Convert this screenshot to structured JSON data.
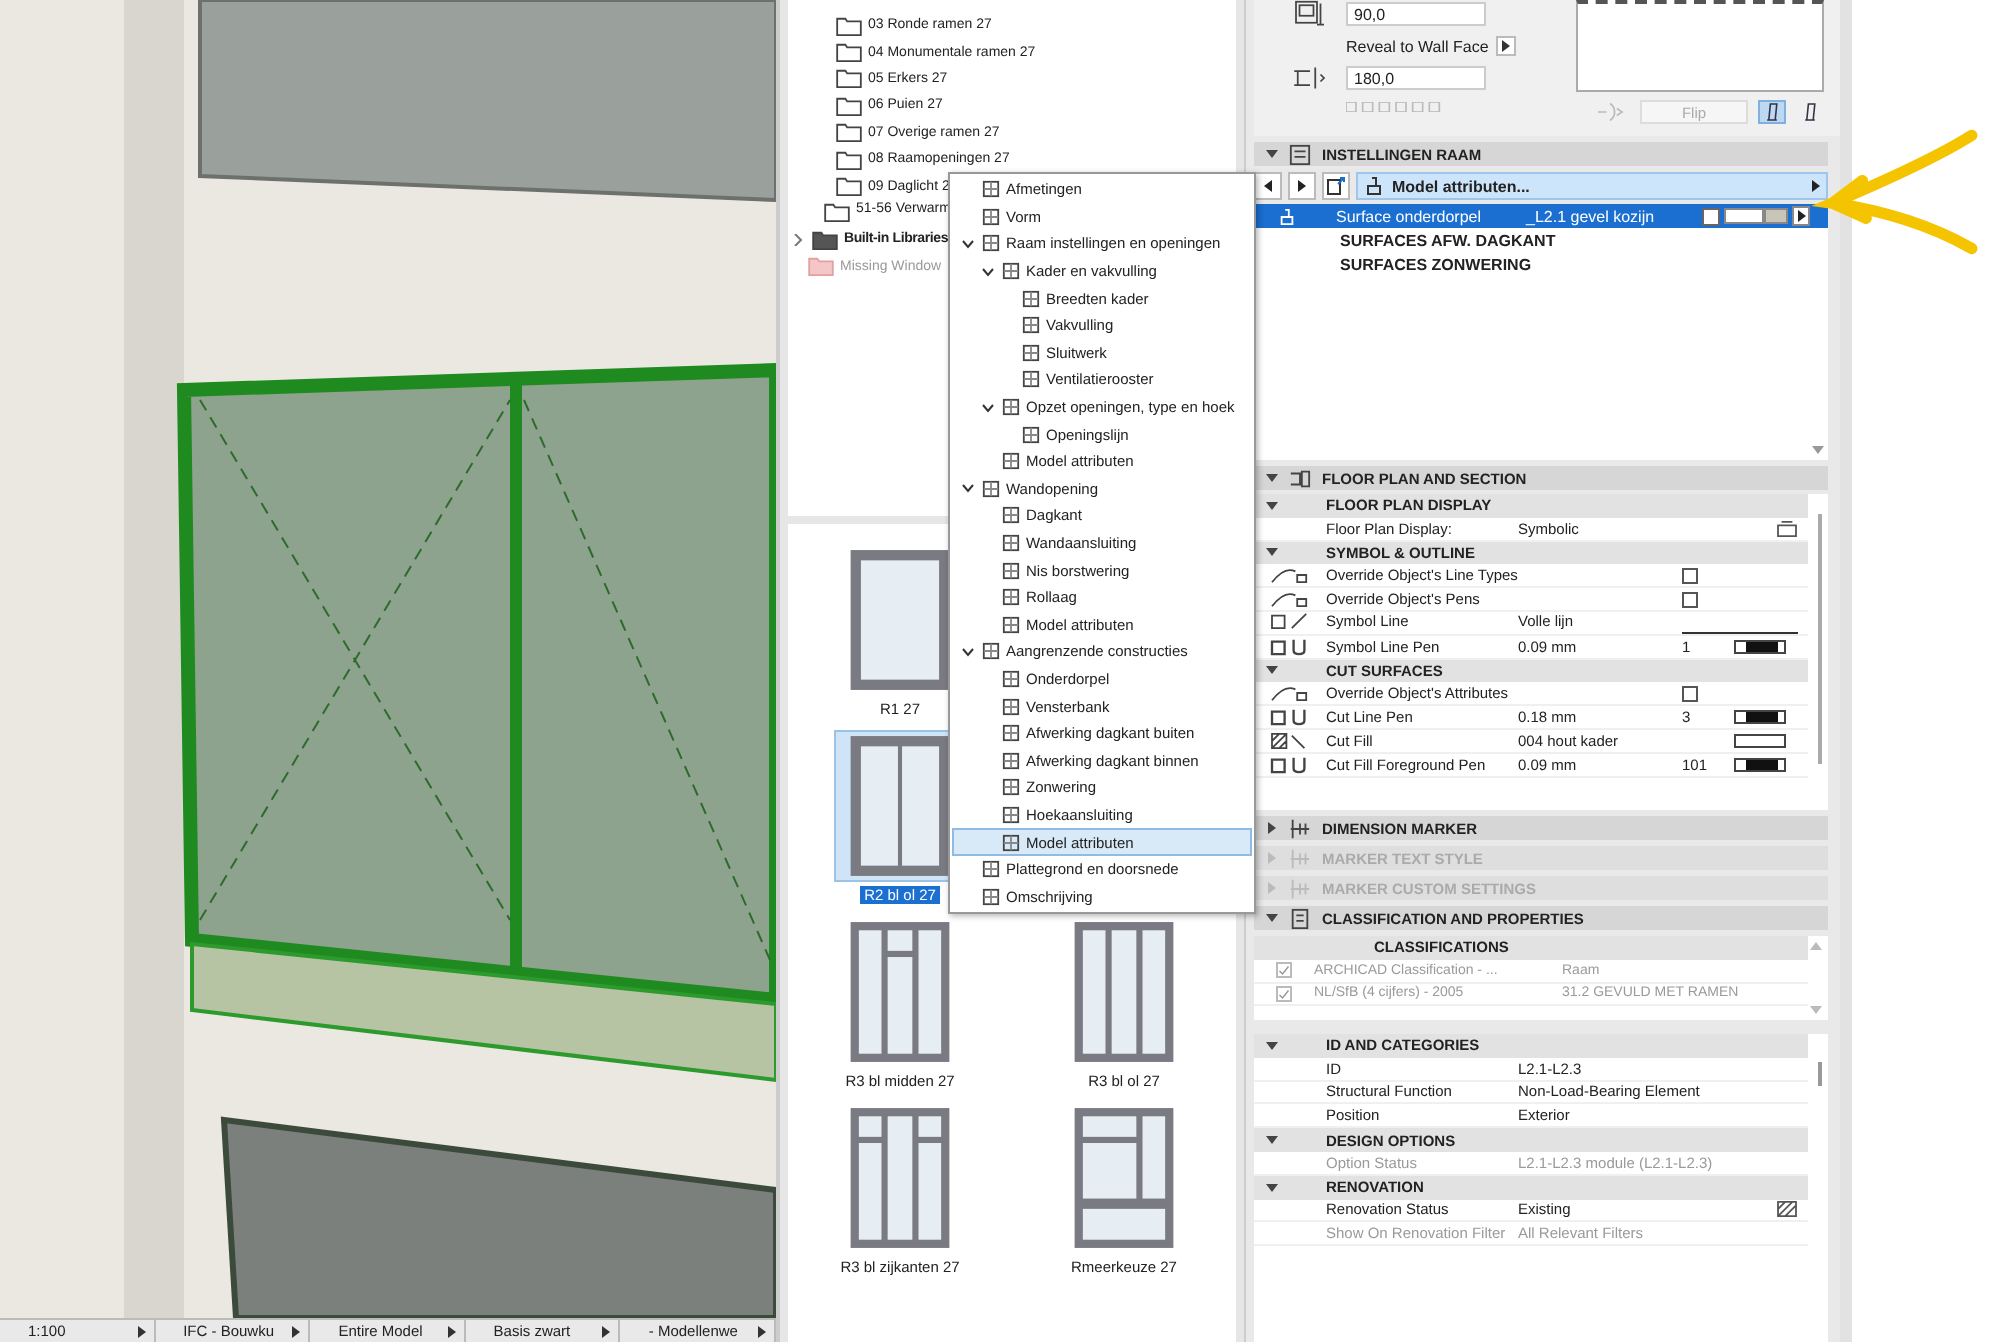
{
  "viewport": {
    "status_bar": [
      {
        "label": "1:100"
      },
      {
        "label": "IFC - Bouwku"
      },
      {
        "label": "Entire Model"
      },
      {
        "label": "Basis zwart"
      },
      {
        "label": "- Modellenwe"
      }
    ]
  },
  "library_tree": {
    "items": [
      {
        "label": "03 Ronde ramen 27",
        "kind": "subfolder"
      },
      {
        "label": "04 Monumentale ramen 27",
        "kind": "subfolder"
      },
      {
        "label": "05 Erkers 27",
        "kind": "subfolder"
      },
      {
        "label": "06 Puien 27",
        "kind": "subfolder"
      },
      {
        "label": "07 Overige ramen 27",
        "kind": "subfolder"
      },
      {
        "label": "08 Raamopeningen 27",
        "kind": "subfolder"
      },
      {
        "label": "09 Daglicht 2",
        "kind": "subfolder"
      },
      {
        "label": "51-56 Verwarm",
        "kind": "folder"
      },
      {
        "label": "Built-in Libraries",
        "kind": "library",
        "expanded": false
      },
      {
        "label": "Missing Window",
        "kind": "missing"
      }
    ]
  },
  "thumbnails": {
    "rows": [
      [
        {
          "label": "R1 27",
          "kind": "single",
          "selected": false
        }
      ],
      [
        {
          "label": "R2 bl ol 27",
          "kind": "double",
          "selected": true
        }
      ],
      [
        {
          "label": "R3 bl midden 27",
          "kind": "triple-middle",
          "selected": false
        },
        {
          "label": "R3 bl ol 27",
          "kind": "triple",
          "selected": false
        }
      ],
      [
        {
          "label": "R3 bl zijkanten 27",
          "kind": "triple-sides",
          "selected": false
        },
        {
          "label": "Rmeerkeuze 27",
          "kind": "multi",
          "selected": false
        }
      ]
    ]
  },
  "menu": {
    "items": [
      {
        "label": "Afmetingen",
        "selected": false
      },
      {
        "label": "Vorm",
        "selected": false
      },
      {
        "label": "Raam instellingen en openingen",
        "selected": false,
        "expanded": true,
        "children": [
          {
            "label": "Kader en vakvulling",
            "selected": false,
            "expanded": true,
            "children": [
              {
                "label": "Breedten kader",
                "selected": false
              },
              {
                "label": "Vakvulling",
                "selected": false
              },
              {
                "label": "Sluitwerk",
                "selected": false
              },
              {
                "label": "Ventilatierooster",
                "selected": false
              }
            ]
          },
          {
            "label": "Opzet openingen, type en hoek",
            "selected": false,
            "expanded": true,
            "children": [
              {
                "label": "Openingslijn",
                "selected": false
              }
            ]
          },
          {
            "label": "Model attributen",
            "selected": false
          }
        ]
      },
      {
        "label": "Wandopening",
        "selected": false,
        "expanded": true,
        "children": [
          {
            "label": "Dagkant",
            "selected": false
          },
          {
            "label": "Wandaansluiting",
            "selected": false
          },
          {
            "label": "Nis borstwering",
            "selected": false
          },
          {
            "label": "Rollaag",
            "selected": false
          },
          {
            "label": "Model attributen",
            "selected": false
          }
        ]
      },
      {
        "label": "Aangrenzende constructies",
        "selected": false,
        "expanded": true,
        "children": [
          {
            "label": "Onderdorpel",
            "selected": false
          },
          {
            "label": "Vensterbank",
            "selected": false
          },
          {
            "label": "Afwerking dagkant buiten",
            "selected": false
          },
          {
            "label": "Afwerking dagkant binnen",
            "selected": false
          },
          {
            "label": "Zonwering",
            "selected": false
          },
          {
            "label": "Hoekaansluiting",
            "selected": false
          },
          {
            "label": "Model attributen",
            "selected": true
          }
        ]
      },
      {
        "label": "Plattegrond en doorsnede",
        "selected": false
      },
      {
        "label": "Omschrijving",
        "selected": false
      }
    ]
  },
  "window_settings": {
    "field_1": "90,0",
    "reveal_label": "Reveal to Wall Face",
    "field_2": "180,0",
    "flip_button": {
      "label": "Flip",
      "disabled": true
    },
    "orientation_toggles": [
      {
        "selected": true
      },
      {
        "selected": false
      }
    ]
  },
  "instellingen_raam": {
    "title": "INSTELLINGEN RAAM",
    "expanded": true,
    "dropdown": "Model attributen...",
    "rows": [
      {
        "kind": "surface",
        "label": "Surface onderdorpel",
        "value": "_L2.1 gevel kozijn",
        "selected": true
      },
      {
        "kind": "heading",
        "label": "SURFACES AFW. DAGKANT",
        "selected": false
      },
      {
        "kind": "heading",
        "label": "SURFACES ZONWERING",
        "selected": false
      }
    ]
  },
  "floor_plan_section": {
    "title": "FLOOR PLAN AND SECTION",
    "expanded": true,
    "groups": [
      {
        "title": "FLOOR PLAN DISPLAY",
        "expanded": true,
        "rows": [
          {
            "kind": "icon-value",
            "label": "Floor Plan Display:",
            "value": "Symbolic"
          }
        ]
      },
      {
        "title": "SYMBOL & OUTLINE",
        "expanded": true,
        "rows": [
          {
            "kind": "checkbox",
            "label": "Override Object's Line Types",
            "checked": false
          },
          {
            "kind": "checkbox",
            "label": "Override Object's Pens",
            "checked": false
          },
          {
            "kind": "line",
            "label": "Symbol Line",
            "value": "Volle lijn"
          },
          {
            "kind": "pen",
            "label": "Symbol Line Pen",
            "value": "0.09 mm",
            "number": "1"
          }
        ]
      },
      {
        "title": "CUT SURFACES",
        "expanded": true,
        "rows": [
          {
            "kind": "checkbox",
            "label": "Override Object's Attributes",
            "checked": false
          },
          {
            "kind": "pen",
            "label": "Cut Line Pen",
            "value": "0.18 mm",
            "number": "3"
          },
          {
            "kind": "fill",
            "label": "Cut Fill",
            "value": "004 hout kader"
          },
          {
            "kind": "pen",
            "label": "Cut Fill Foreground Pen",
            "value": "0.09 mm",
            "number": "101"
          }
        ]
      }
    ]
  },
  "collapsed_sections": [
    {
      "title": "DIMENSION MARKER",
      "expanded": false,
      "disabled": false
    },
    {
      "title": "MARKER TEXT STYLE",
      "expanded": false,
      "disabled": true
    },
    {
      "title": "MARKER CUSTOM SETTINGS",
      "expanded": false,
      "disabled": true
    }
  ],
  "classification": {
    "title": "CLASSIFICATION AND PROPERTIES",
    "expanded": true,
    "subtitle": "CLASSIFICATIONS",
    "rows": [
      {
        "label": "ARCHICAD Classification - ...",
        "value": "Raam",
        "checked": true,
        "disabled": true
      },
      {
        "label": "NL/SfB (4 cijfers) - 2005",
        "value": "31.2 GEVULD MET RAMEN",
        "checked": true,
        "disabled": true
      }
    ]
  },
  "properties": {
    "groups": [
      {
        "title": "ID AND CATEGORIES",
        "expanded": true,
        "rows": [
          {
            "kind": "text",
            "label": "ID",
            "value": "L2.1-L2.3",
            "disabled": false
          },
          {
            "kind": "text",
            "label": "Structural Function",
            "value": "Non-Load-Bearing Element",
            "disabled": false
          },
          {
            "kind": "text",
            "label": "Position",
            "value": "Exterior",
            "disabled": false
          }
        ]
      },
      {
        "title": "DESIGN OPTIONS",
        "expanded": true,
        "rows": [
          {
            "kind": "text",
            "label": "Option Status",
            "value": "L2.1-L2.3 module (L2.1-L2.3)",
            "disabled": true
          }
        ]
      },
      {
        "title": "RENOVATION",
        "expanded": true,
        "rows": [
          {
            "kind": "icon-value",
            "label": "Renovation Status",
            "value": "Existing",
            "disabled": false
          },
          {
            "kind": "text",
            "label": "Show On Renovation Filter",
            "value": "All Relevant Filters",
            "disabled": true
          }
        ]
      }
    ]
  }
}
